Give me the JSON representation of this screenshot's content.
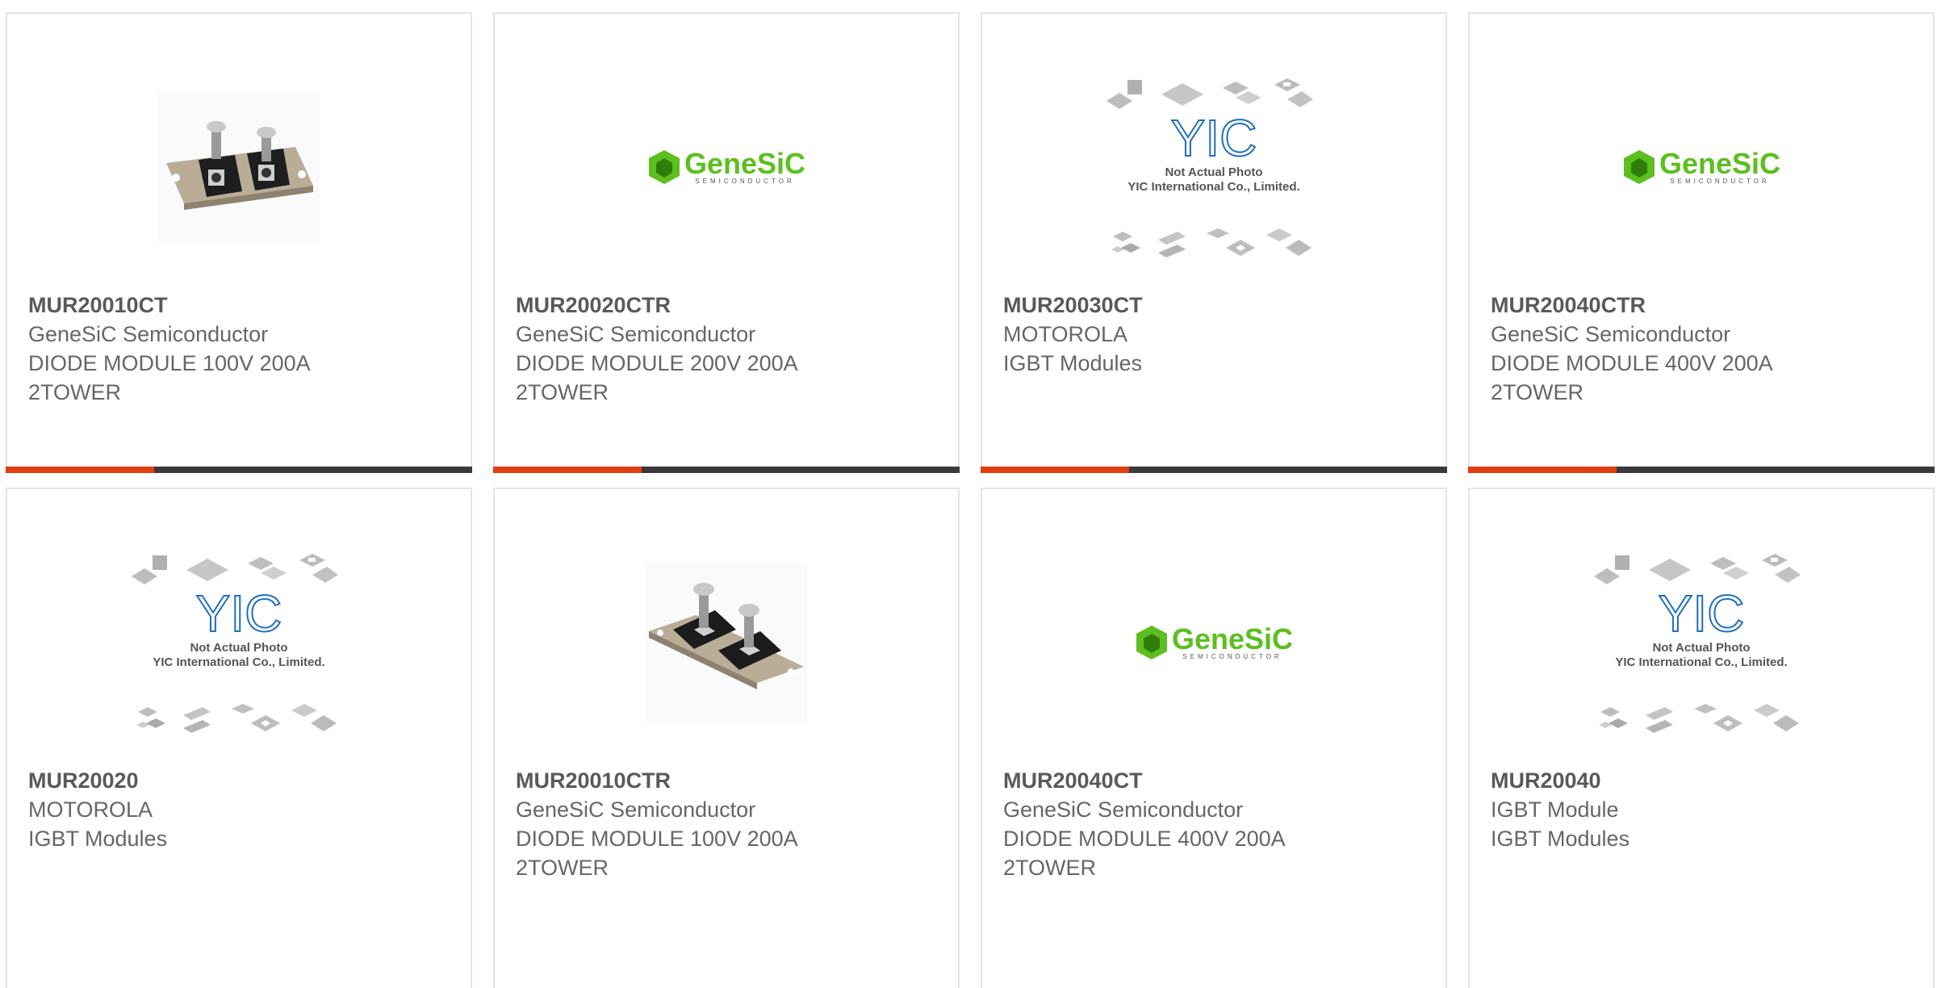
{
  "colors": {
    "accent": "#e43d10",
    "bar": "#3a3a3a",
    "genesic_green": "#5cbf1f",
    "yic_blue": "#1f6fbf"
  },
  "products": [
    {
      "part": "MUR20010CT",
      "manufacturer": "GeneSiC Semiconductor",
      "description": "DIODE MODULE 100V 200A 2TOWER",
      "image": "diode-module-photo"
    },
    {
      "part": "MUR20020CTR",
      "manufacturer": "GeneSiC Semiconductor",
      "description": "DIODE MODULE 200V 200A 2TOWER",
      "image": "genesic-logo"
    },
    {
      "part": "MUR20030CT",
      "manufacturer": "MOTOROLA",
      "description": "IGBT Modules",
      "image": "yic-placeholder"
    },
    {
      "part": "MUR20040CTR",
      "manufacturer": "GeneSiC Semiconductor",
      "description": "DIODE MODULE 400V 200A 2TOWER",
      "image": "genesic-logo"
    },
    {
      "part": "MUR20020",
      "manufacturer": "MOTOROLA",
      "description": "IGBT Modules",
      "image": "yic-placeholder"
    },
    {
      "part": "MUR20010CTR",
      "manufacturer": "GeneSiC Semiconductor",
      "description": "DIODE MODULE 100V 200A 2TOWER",
      "image": "diode-module-photo"
    },
    {
      "part": "MUR20040CT",
      "manufacturer": "GeneSiC Semiconductor",
      "description": "DIODE MODULE 400V 200A 2TOWER",
      "image": "genesic-logo"
    },
    {
      "part": "MUR20040",
      "manufacturer": "IGBT Module",
      "description": "IGBT Modules",
      "image": "yic-placeholder"
    }
  ],
  "logos": {
    "genesic": {
      "name": "GeneSiC",
      "tagline": "SEMICONDUCTOR"
    },
    "yic": {
      "mark": "YIC",
      "line1": "Not Actual Photo",
      "line2": "YIC International Co., Limited."
    }
  }
}
